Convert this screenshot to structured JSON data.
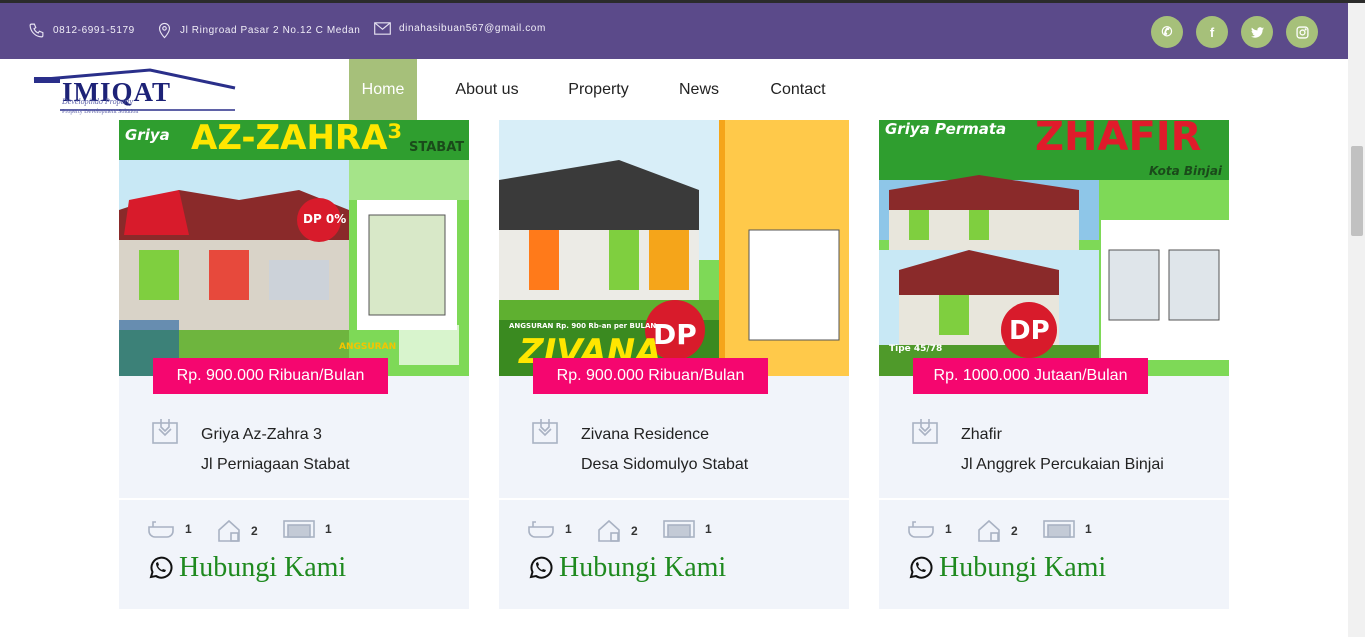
{
  "topbar": {
    "phone": "0812-6991-5179",
    "address": "Jl Ringroad Pasar 2 No.12 C Medan",
    "email": "dinahasibuan567@gmail.com",
    "social": [
      {
        "icon": "whatsapp-icon",
        "glyph": "✆"
      },
      {
        "icon": "facebook-icon",
        "glyph": "f"
      },
      {
        "icon": "twitter-icon",
        "glyph": "🐦"
      },
      {
        "icon": "instagram-icon",
        "glyph": "◎"
      }
    ],
    "bg": "#5b4a8a",
    "social_bg": "#a6c07a"
  },
  "logo": {
    "text": "IMIQAT",
    "tagline": "Developindo Property",
    "subtagline": "Property Development Solution"
  },
  "nav": {
    "items": [
      {
        "label": "Home",
        "active": true
      },
      {
        "label": "About us",
        "active": false
      },
      {
        "label": "Property",
        "active": false
      },
      {
        "label": "News",
        "active": false
      },
      {
        "label": "Contact",
        "active": false
      }
    ],
    "active_color": "#a6c07a"
  },
  "cards": [
    {
      "price": "Rp. 900.000 Ribuan/Bulan",
      "name": "Griya Az-Zahra 3",
      "address": "Jl Perniagaan Stabat",
      "bathrooms": "1",
      "bedrooms": "2",
      "garage": "1",
      "contact_label": "Hubungi Kami",
      "image": {
        "top": "Griya",
        "title": "AZ-ZAHRA³",
        "sub": "STABAT",
        "badge": "DP 0%",
        "bottom": "ANGSURAN"
      }
    },
    {
      "price": "Rp. 900.000 Ribuan/Bulan",
      "name": "Zivana Residence",
      "address": "Desa Sidomulyo Stabat",
      "bathrooms": "1",
      "bedrooms": "2",
      "garage": "1",
      "contact_label": "Hubungi Kami",
      "image": {
        "top": "",
        "title": "ZIVANA",
        "sub": "",
        "badge": "DP",
        "bottom": "ANGSURAN Rp. 900 Rb-an per BULAN"
      }
    },
    {
      "price": "Rp. 1000.000 Jutaan/Bulan",
      "name": "Zhafir",
      "address": "Jl Anggrek Percukaian Binjai",
      "bathrooms": "1",
      "bedrooms": "2",
      "garage": "1",
      "contact_label": "Hubungi Kami",
      "image": {
        "top": "Griya Permata",
        "title": "ZHAFIR",
        "sub": "Kota Binjai",
        "badge": "DP",
        "bottom": "Tipe 45/78"
      }
    }
  ],
  "colors": {
    "price_bg": "#f5066f",
    "card_bg": "#f1f4fa",
    "contact_green": "#1f8a1f"
  }
}
